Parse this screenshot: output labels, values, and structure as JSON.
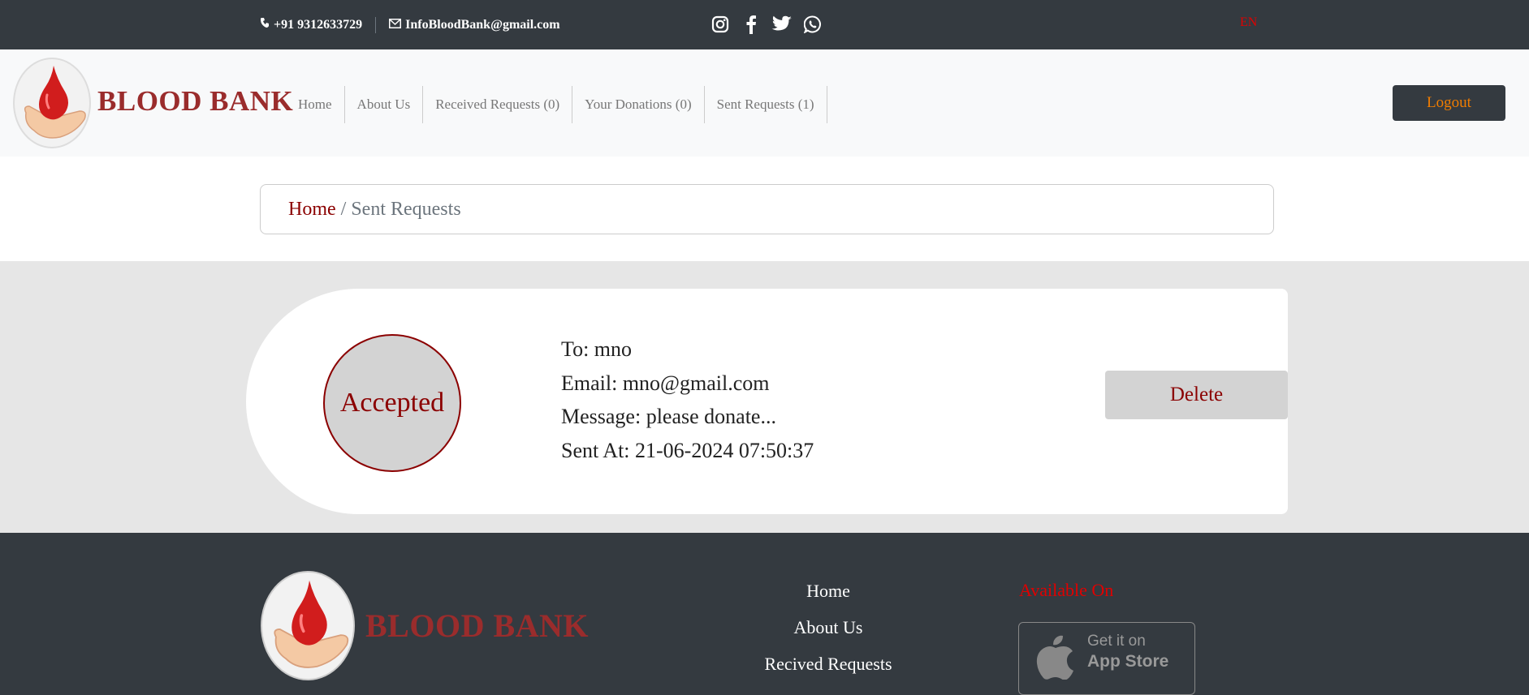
{
  "topbar": {
    "phone": "+91 9312633729",
    "email": "InfoBloodBank@gmail.com",
    "language": "EN",
    "social": [
      "instagram-icon",
      "facebook-icon",
      "twitter-icon",
      "whatsapp-icon"
    ]
  },
  "nav": {
    "brand": "BLOOD BANK",
    "links": [
      "Home",
      "About Us",
      "Received Requests (0)",
      "Your Donations (0)",
      "Sent Requests (1)"
    ],
    "logout": "Logout"
  },
  "breadcrumb": {
    "home": "Home",
    "separator": "/",
    "current": "Sent Requests"
  },
  "request": {
    "status": "Accepted",
    "to": "To: mno",
    "email": "Email: mno@gmail.com",
    "message": "Message: please donate...",
    "sent_at": "Sent At: 21-06-2024 07:50:37",
    "delete_label": "Delete"
  },
  "footer": {
    "brand": "BLOOD BANK",
    "links": [
      "Home",
      "About Us",
      "Recived Requests"
    ],
    "available_on": "Available On",
    "appstore_small": "Get it on",
    "appstore_big": "App Store"
  },
  "colors": {
    "dark": "#343a40",
    "accent_red": "#8b0000",
    "brand_red": "#9a2c2c",
    "logout_orange": "#f07d00"
  }
}
